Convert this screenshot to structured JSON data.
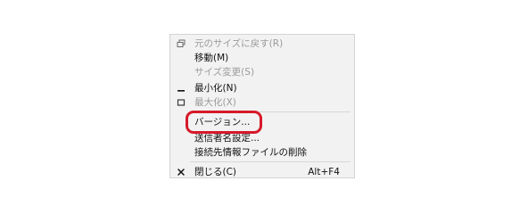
{
  "menu": {
    "items": [
      {
        "label": "元のサイズに戻す(R)",
        "icon": "restore-icon",
        "disabled": true
      },
      {
        "label": "移動(M)",
        "icon": "",
        "disabled": false
      },
      {
        "label": "サイズ変更(S)",
        "icon": "",
        "disabled": true
      },
      {
        "label": "最小化(N)",
        "icon": "minimize-icon",
        "disabled": false
      },
      {
        "label": "最大化(X)",
        "icon": "maximize-icon",
        "disabled": true
      },
      {
        "label": "バージョン...",
        "icon": "",
        "disabled": false
      },
      {
        "label": "送信者名設定...",
        "icon": "",
        "disabled": false
      },
      {
        "label": "接続先情報ファイルの削除",
        "icon": "",
        "disabled": false
      },
      {
        "label": "閉じる(C)",
        "icon": "close-icon",
        "disabled": false,
        "shortcut": "Alt+F4"
      }
    ]
  },
  "colors": {
    "menu_background": "#f2f2f2",
    "disabled_text": "#9a9a9a",
    "highlight": "#d61a2a"
  }
}
